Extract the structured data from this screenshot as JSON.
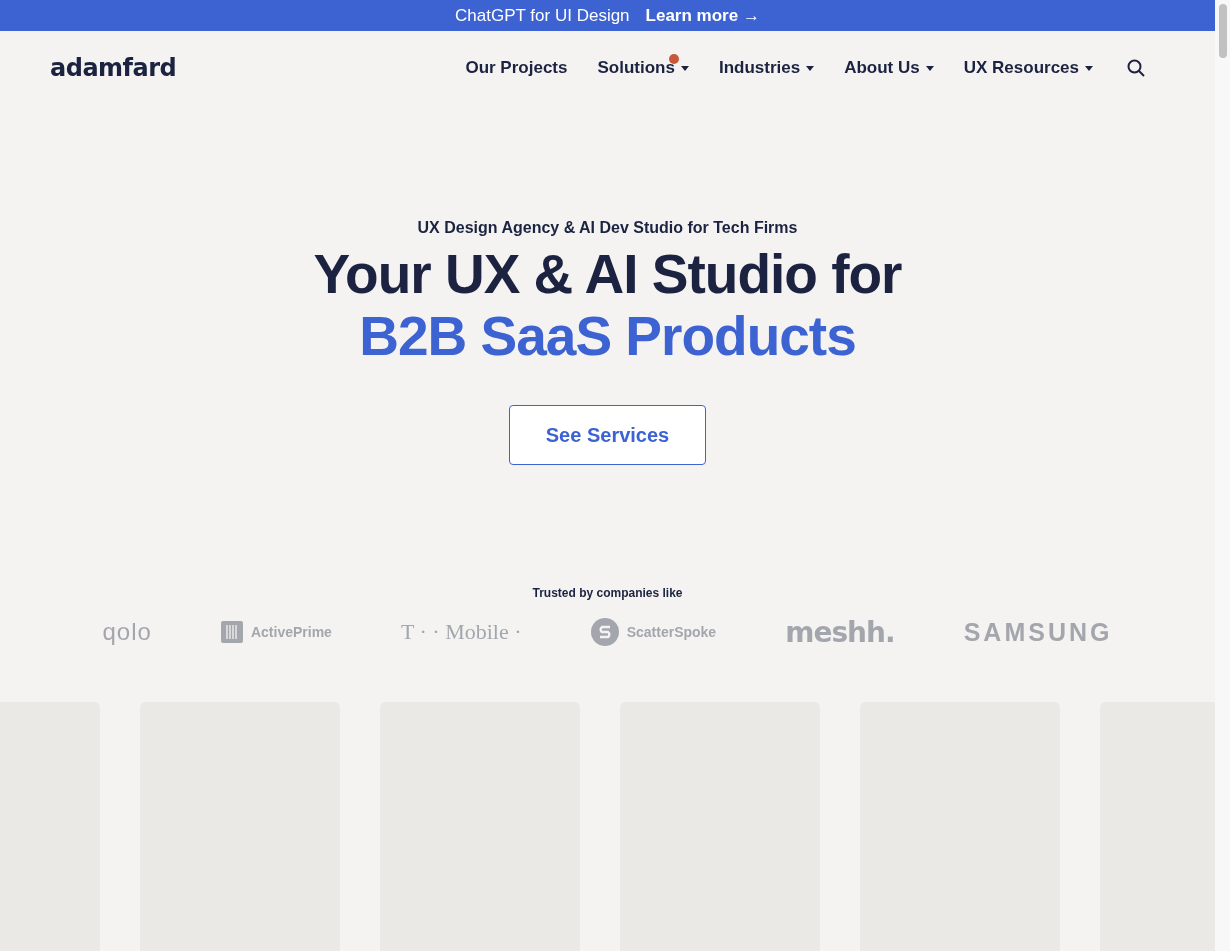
{
  "banner": {
    "text": "ChatGPT for UI Design",
    "link": "Learn more →"
  },
  "header": {
    "logo": "adamfard",
    "nav": [
      {
        "label": "Our Projects",
        "has_menu": false,
        "badge": false
      },
      {
        "label": "Solutions",
        "has_menu": true,
        "badge": true
      },
      {
        "label": "Industries",
        "has_menu": true,
        "badge": false
      },
      {
        "label": "About Us",
        "has_menu": true,
        "badge": false
      },
      {
        "label": "UX Resources",
        "has_menu": true,
        "badge": false
      }
    ]
  },
  "hero": {
    "eyebrow": "UX Design Agency & AI Dev Studio for Tech Firms",
    "title": "Your UX & AI Studio for",
    "title_accent": "B2B SaaS Products",
    "button": "See Services"
  },
  "trusted": {
    "label": "Trusted by companies like",
    "logos": [
      {
        "text": "qolo",
        "kind": "plain"
      },
      {
        "text": "ActivePrime",
        "kind": "bars"
      },
      {
        "text": "T · · Mobile ·",
        "kind": "serif"
      },
      {
        "text": "ScatterSpoke",
        "kind": "circle"
      },
      {
        "text": "meshh.",
        "kind": "heavy"
      },
      {
        "text": "SAMSUNG",
        "kind": "wide"
      }
    ]
  },
  "cards": [
    {
      "kind": "placeholder"
    },
    {
      "kind": "placeholder"
    },
    {
      "kind": "placeholder"
    },
    {
      "kind": "placeholder"
    },
    {
      "kind": "placeholder"
    },
    {
      "kind": "placeholder"
    }
  ]
}
